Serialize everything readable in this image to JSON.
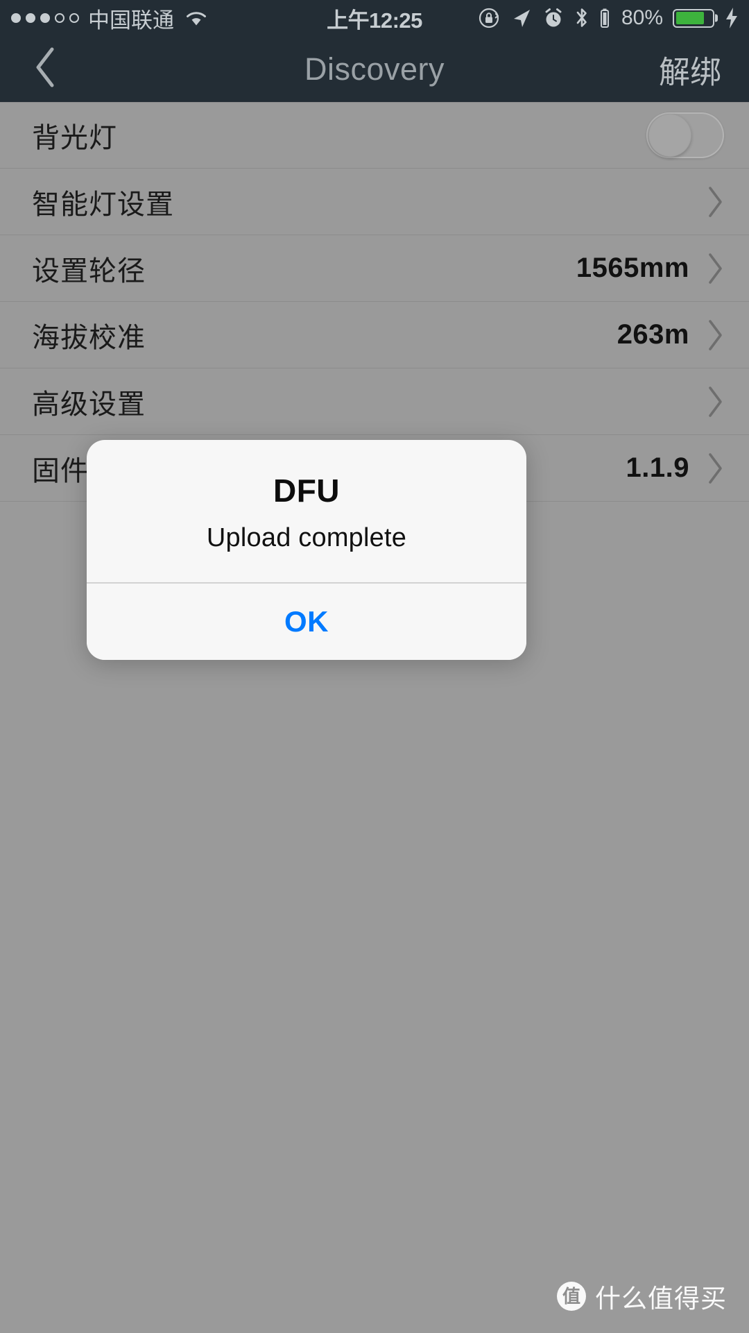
{
  "statusbar": {
    "signal_dots_total": 5,
    "signal_dots_filled": 3,
    "carrier": "中国联通",
    "wifi_icon": "wifi-icon",
    "time": "上午12:25",
    "right_icons": [
      "rotation-lock-icon",
      "location-arrow-icon",
      "alarm-clock-icon",
      "bluetooth-icon",
      "device-battery-icon"
    ],
    "battery_percent": "80%",
    "battery_fill_percent": 80,
    "battery_color": "#3db33d",
    "charging_icon": "lightning-bolt-icon"
  },
  "navbar": {
    "back_icon": "chevron-left-icon",
    "title": "Discovery",
    "action_label": "解绑"
  },
  "list": {
    "rows": [
      {
        "label": "背光灯",
        "value": "",
        "control": "switch",
        "switch_on": false
      },
      {
        "label": "智能灯设置",
        "value": "",
        "control": "chevron"
      },
      {
        "label": "设置轮径",
        "value": "1565mm",
        "control": "chevron"
      },
      {
        "label": "海拔校准",
        "value": "263m",
        "control": "chevron"
      },
      {
        "label": "高级设置",
        "value": "",
        "control": "chevron"
      },
      {
        "label": "固件升级",
        "value": "1.1.9",
        "control": "chevron"
      }
    ]
  },
  "alert": {
    "title": "DFU",
    "message": "Upload complete",
    "ok_label": "OK",
    "ok_color": "#007aff"
  },
  "watermark": {
    "logo_char": "值",
    "text": "什么值得买"
  }
}
